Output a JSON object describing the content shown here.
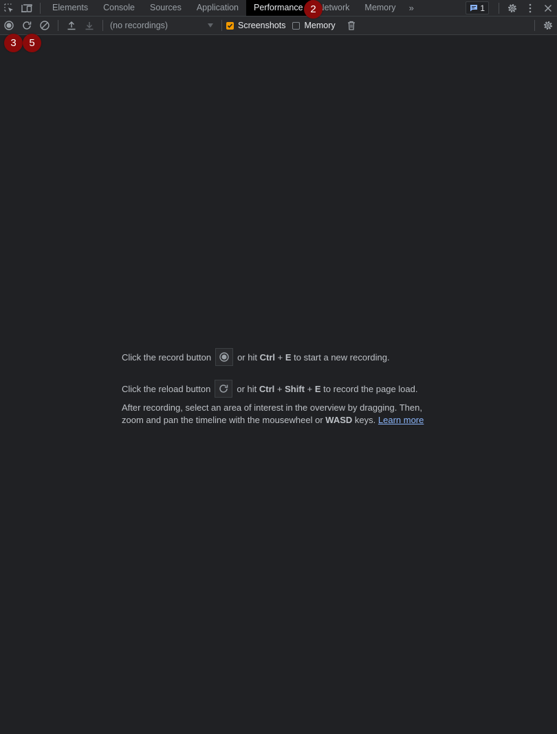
{
  "tabbar": {
    "tabs": [
      {
        "label": "Elements"
      },
      {
        "label": "Console"
      },
      {
        "label": "Sources"
      },
      {
        "label": "Application"
      },
      {
        "label": "Performance",
        "active": true
      },
      {
        "label": "Network"
      },
      {
        "label": "Memory"
      }
    ],
    "more_tabs_glyph": "»",
    "issues_count": "1",
    "icons": [
      "inspect-element-icon",
      "device-toolbar-icon",
      "settings-icon",
      "more-options-icon",
      "close-icon"
    ]
  },
  "toolbar": {
    "recordings_select": "(no recordings)",
    "screenshots_label": "Screenshots",
    "screenshots_checked": true,
    "memory_label": "Memory",
    "memory_checked": false,
    "accent_color": "#f29900"
  },
  "markers": [
    {
      "label": "2"
    },
    {
      "label": "3"
    },
    {
      "label": "5"
    }
  ],
  "landing": {
    "record_prefix": "Click the record button",
    "record_mid": "or hit",
    "record_key1": "Ctrl",
    "plus": "+",
    "record_key2": "E",
    "record_suffix": "to start a new recording.",
    "reload_prefix": "Click the reload button",
    "reload_mid": "or hit",
    "reload_key1": "Ctrl",
    "reload_key2": "Shift",
    "reload_key3": "E",
    "reload_suffix": "to record the page load.",
    "after_text1": "After recording, select an area of interest in the overview by dragging. Then, zoom and pan the timeline with the mousewheel or",
    "after_bold": "WASD",
    "after_text2": "keys.",
    "learn_more": "Learn more"
  }
}
